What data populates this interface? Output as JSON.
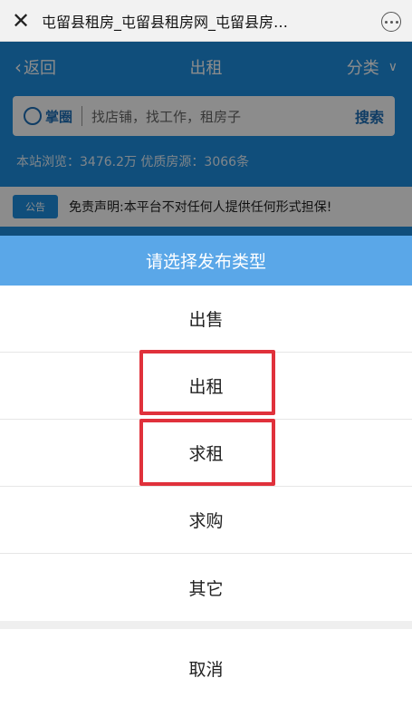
{
  "titlebar": {
    "close_icon": "close-icon",
    "title": "屯留县租房_屯留县租房网_屯留县房…",
    "more_icon": "more-icon"
  },
  "page": {
    "nav": {
      "back_label": "返回",
      "title": "出租",
      "category_label": "分类"
    },
    "search": {
      "logo_text": "掌圈",
      "placeholder": "找店铺，找工作，租房子",
      "button_label": "搜索"
    },
    "stats": "本站浏览：3476.2万  优质房源：3066条",
    "notice": {
      "tag": "公告",
      "text": "免责声明:本平台不对任何人提供任何形式担保!"
    }
  },
  "sheet": {
    "header": "请选择发布类型",
    "options": [
      "出售",
      "出租",
      "求租",
      "求购",
      "其它"
    ],
    "cancel": "取消"
  },
  "colors": {
    "page_blue": "#1e8fe0",
    "sheet_header": "#5aa7e8",
    "highlight": "#e0313b"
  }
}
